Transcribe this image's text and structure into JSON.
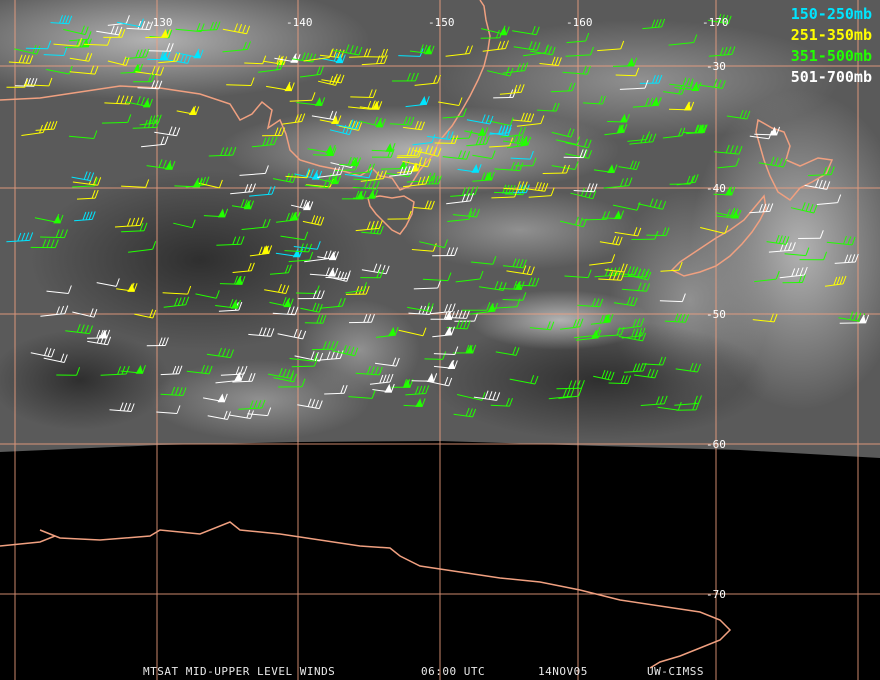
{
  "map": {
    "longitude_labels": [
      "-130",
      "-140",
      "-150",
      "-160",
      "-170"
    ],
    "latitude_labels": [
      "-30",
      "-40",
      "-50",
      "-60",
      "-70"
    ],
    "grid_color": "#f0a080",
    "coast_color": "#f0a080",
    "satellite_band": "water vapor"
  },
  "legend": [
    {
      "label": "150-250mb",
      "color": "#00e5ff"
    },
    {
      "label": "251-350mb",
      "color": "#ffff00"
    },
    {
      "label": "351-500mb",
      "color": "#22ff00"
    },
    {
      "label": "501-700mb",
      "color": "#ffffff"
    }
  ],
  "footer": {
    "product": "MTSAT MID-UPPER LEVEL WINDS",
    "time": "06:00 UTC",
    "date": "14NOV05",
    "credit": "UW-CIMSS"
  }
}
